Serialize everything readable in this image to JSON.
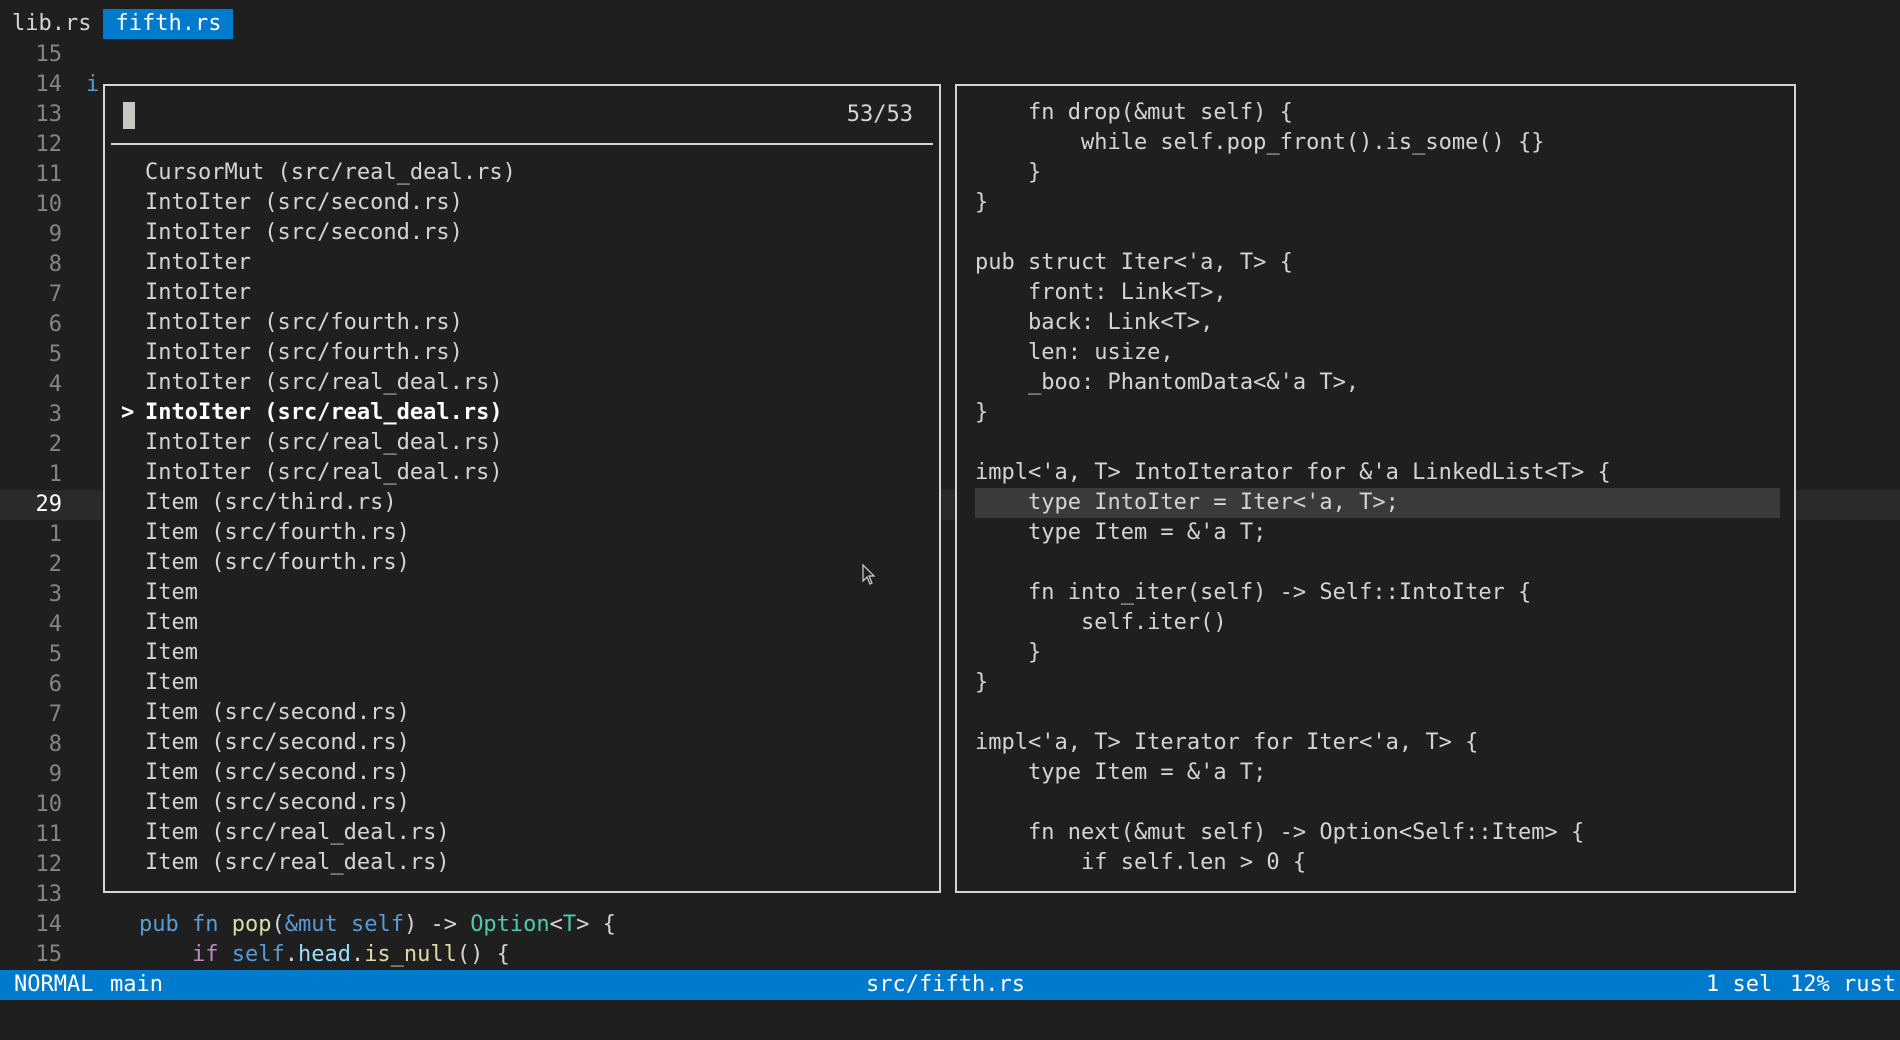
{
  "tabs": [
    {
      "label": "lib.rs",
      "active": false
    },
    {
      "label": "fifth.rs",
      "active": true
    }
  ],
  "editor": {
    "gutter": [
      "15",
      "14",
      "13",
      "12",
      "11",
      "10",
      "9",
      "8",
      "7",
      "6",
      "5",
      "4",
      "3",
      "2",
      "1",
      "29",
      "1",
      "2",
      "3",
      "4",
      "5",
      "6",
      "7",
      "8",
      "9",
      "10",
      "11",
      "12",
      "13",
      "14",
      "15"
    ],
    "current_line_index": 15,
    "visible_fragment": "i",
    "bottom_lines": [
      {
        "indent": "    ",
        "tokens": [
          [
            "k",
            "pub"
          ],
          [
            "p",
            " "
          ],
          [
            "k",
            "fn"
          ],
          [
            "p",
            " "
          ],
          [
            "f",
            "pop"
          ],
          [
            "p",
            "("
          ],
          [
            "k",
            "&mut"
          ],
          [
            "p",
            " "
          ],
          [
            "k",
            "self"
          ],
          [
            "p",
            ") -> "
          ],
          [
            "t",
            "Option"
          ],
          [
            "p",
            "<"
          ],
          [
            "t",
            "T"
          ],
          [
            "p",
            "> {"
          ]
        ]
      },
      {
        "indent": "        ",
        "tokens": [
          [
            "c",
            "if"
          ],
          [
            "p",
            " "
          ],
          [
            "k",
            "self"
          ],
          [
            "p",
            "."
          ],
          [
            "v",
            "head"
          ],
          [
            "p",
            "."
          ],
          [
            "f",
            "is_null"
          ],
          [
            "p",
            "() {"
          ]
        ]
      }
    ]
  },
  "picker": {
    "query": "",
    "count": "53/53",
    "selected_index": 8,
    "items": [
      "CursorMut (src/real_deal.rs)",
      "IntoIter (src/second.rs)",
      "IntoIter (src/second.rs)",
      "IntoIter",
      "IntoIter",
      "IntoIter (src/fourth.rs)",
      "IntoIter (src/fourth.rs)",
      "IntoIter (src/real_deal.rs)",
      "IntoIter (src/real_deal.rs)",
      "IntoIter (src/real_deal.rs)",
      "IntoIter (src/real_deal.rs)",
      "Item (src/third.rs)",
      "Item (src/fourth.rs)",
      "Item (src/fourth.rs)",
      "Item",
      "Item",
      "Item",
      "Item",
      "Item (src/second.rs)",
      "Item (src/second.rs)",
      "Item (src/second.rs)",
      "Item (src/second.rs)",
      "Item (src/real_deal.rs)",
      "Item (src/real_deal.rs)"
    ]
  },
  "preview": {
    "highlight_index": 13,
    "lines": [
      "    fn drop(&mut self) {",
      "        while self.pop_front().is_some() {}",
      "    }",
      "}",
      "",
      "pub struct Iter<'a, T> {",
      "    front: Link<T>,",
      "    back: Link<T>,",
      "    len: usize,",
      "    _boo: PhantomData<&'a T>,",
      "}",
      "",
      "impl<'a, T> IntoIterator for &'a LinkedList<T> {",
      "    type IntoIter = Iter<'a, T>;",
      "    type Item = &'a T;",
      "",
      "    fn into_iter(self) -> Self::IntoIter {",
      "        self.iter()",
      "    }",
      "}",
      "",
      "impl<'a, T> Iterator for Iter<'a, T> {",
      "    type Item = &'a T;",
      "",
      "    fn next(&mut self) -> Option<Self::Item> {",
      "        if self.len > 0 {"
    ]
  },
  "status": {
    "mode": "NORMAL",
    "branch": "main",
    "file": "src/fifth.rs",
    "selections": "1 sel",
    "position": "12% rust"
  },
  "icons": {
    "mouse": "mouse-pointer-icon",
    "selected_marker": ">"
  },
  "colors": {
    "accent": "#007acc",
    "background": "#1f1f1f",
    "keyword": "#569cd6",
    "function": "#dcdcaa",
    "type": "#4ec9b0"
  }
}
